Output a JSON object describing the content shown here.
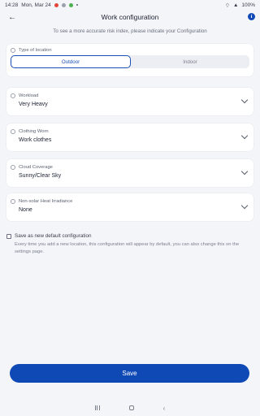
{
  "status_bar": {
    "time": "14:28",
    "date": "Mon, Mar 24",
    "battery": "100%"
  },
  "header": {
    "title": "Work configuration",
    "back_label": "←",
    "info_label": "i"
  },
  "subtitle": "To see a more accurate risk index, please indicate your Configuration",
  "location": {
    "label": "Type of location",
    "options": [
      "Outdoor",
      "Indoor"
    ],
    "selected": "Outdoor"
  },
  "workload": {
    "label": "Workload",
    "value": "Very Heavy"
  },
  "clothing": {
    "label": "Clothing Worn",
    "value": "Work clothes"
  },
  "cloud": {
    "label": "Cloud Coverage",
    "value": "Sunny/Clear Sky"
  },
  "irradiance": {
    "label": "Non-solar Heat Irradiance",
    "value": "None"
  },
  "default_config": {
    "label": "Save as new default configuration",
    "help": "Every time you add a new location, this configuration will appear by default, you can also change this on the settings page.",
    "checked": false
  },
  "save_label": "Save",
  "colors": {
    "primary": "#0f49b5",
    "background": "#f4f5f8"
  }
}
